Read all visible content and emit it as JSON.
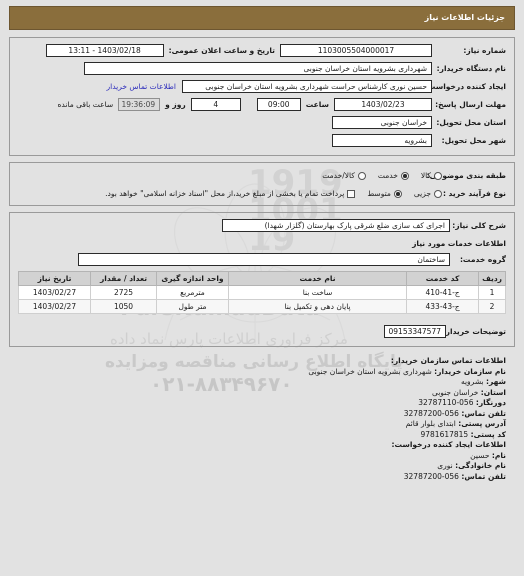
{
  "header": {
    "title": "جزئیات اطلاعات نیاز"
  },
  "colors": {
    "header_bar": "#8a6e3c",
    "link": "#2b2bbb",
    "page_bg": "#e2e2e2",
    "table_header_bg": "#d2d2d2"
  },
  "summary": {
    "need_number_label": "شماره نیاز:",
    "need_number_value": "1103005504000017",
    "announce_label": "تاریخ و ساعت اعلان عمومی:",
    "announce_value": "1403/02/18 - 13:11",
    "buyer_org_label": "نام دستگاه خریدار:",
    "buyer_org_value": "شهرداری بشرویه استان خراسان جنوبی",
    "requester_label": "ایجاد کننده درخواست:",
    "requester_value": "حسین نوری کارشناس حراست شهرداری بشرویه استان خراسان جنوبی",
    "contact_link": "اطلاعات تماس خریدار",
    "deadline_label": "مهلت ارسال پاسخ: تا تاریخ:",
    "deadline_date": "1403/02/23",
    "deadline_time_label": "ساعت",
    "deadline_time": "09:00",
    "days_value": "4",
    "days_label": "روز و",
    "countdown_value": "19:36:09",
    "countdown_label": "ساعت باقی مانده",
    "province_label": "استان محل تحویل:",
    "province_value": "خراسان جنوبی",
    "city_label": "شهر محل تحویل:",
    "city_value": "بشرویه"
  },
  "classification": {
    "category_label": "طبقه بندی موضوعی:",
    "options": [
      {
        "label": "کالا",
        "selected": false
      },
      {
        "label": "خدمت",
        "selected": true
      },
      {
        "label": "کالا/خدمت",
        "selected": false
      }
    ],
    "process_label": "نوع فرآیند خرید :",
    "process_options": [
      {
        "label": "جزیی",
        "selected": false
      },
      {
        "label": "متوسط",
        "selected": true
      }
    ],
    "payment_checkbox_label": "پرداخت تمام یا بخشی از مبلغ خرید،از محل \"اسناد خزانه اسلامی\" خواهد بود.",
    "payment_checked": false
  },
  "description": {
    "label": "شرح کلی نیاز:",
    "value": "اجرای کف سازی ضلع شرقی پارک بهارستان (گلزار شهدا)"
  },
  "services": {
    "section_title": "اطلاعات خدمات مورد نیاز",
    "group_label": "گروه خدمت:",
    "group_value": "ساختمان",
    "columns": [
      "ردیف",
      "کد خدمت",
      "نام خدمت",
      "واحد اندازه گیری",
      "تعداد / مقدار",
      "تاریخ نیاز"
    ],
    "rows": [
      {
        "index": "1",
        "code": "ج-41-410",
        "name": "ساخت بنا",
        "unit": "مترمربع",
        "qty": "2725",
        "date": "1403/02/27"
      },
      {
        "index": "2",
        "code": "ج-43-433",
        "name": "پایان دهی و تکمیل بنا",
        "unit": "متر طول",
        "qty": "1050",
        "date": "1403/02/27"
      }
    ],
    "buyer_notes_label": "توضیحات خریدار:",
    "buyer_notes_value": "09153347577"
  },
  "buyer_contact": {
    "section_title": "اطلاعات تماس سازمان خریدار:",
    "org_label": "نام سازمان خریدار:",
    "org_value": "شهرداری بشرویه استان خراسان جنوبی",
    "city_label": "شهر:",
    "city_value": "بشرویه",
    "province_label": "استان:",
    "province_value": "خراسان جنوبی",
    "fax_label": "دورنگار:",
    "fax_value": "32787110-056",
    "phone_label": "تلفن تماس:",
    "phone_value": "32787200-056",
    "address_label": "آدرس پستی:",
    "address_value": "ابتدای بلوار قائم",
    "postal_label": "کد پستی:",
    "postal_value": "9781617815"
  },
  "requester_contact": {
    "section_title": "اطلاعات ایجاد کننده درخواست:",
    "first_name_label": "نام:",
    "first_name_value": "حسین",
    "last_name_label": "نام خانوادگی:",
    "last_name_value": "نوری",
    "phone_label": "تلفن تماس:",
    "phone_value": "32787200-056"
  },
  "watermark": {
    "brand": "ParsNamadData",
    "line1": "مرکز فراوری اطلاعات پارس نماد داده",
    "line2": "پایگاه اطلاع رسانی مناقصه ومزایده",
    "phone": "۰۲۱-۸۸۳۴۹۶۷۰",
    "digits": "1919\n1001\n19"
  }
}
